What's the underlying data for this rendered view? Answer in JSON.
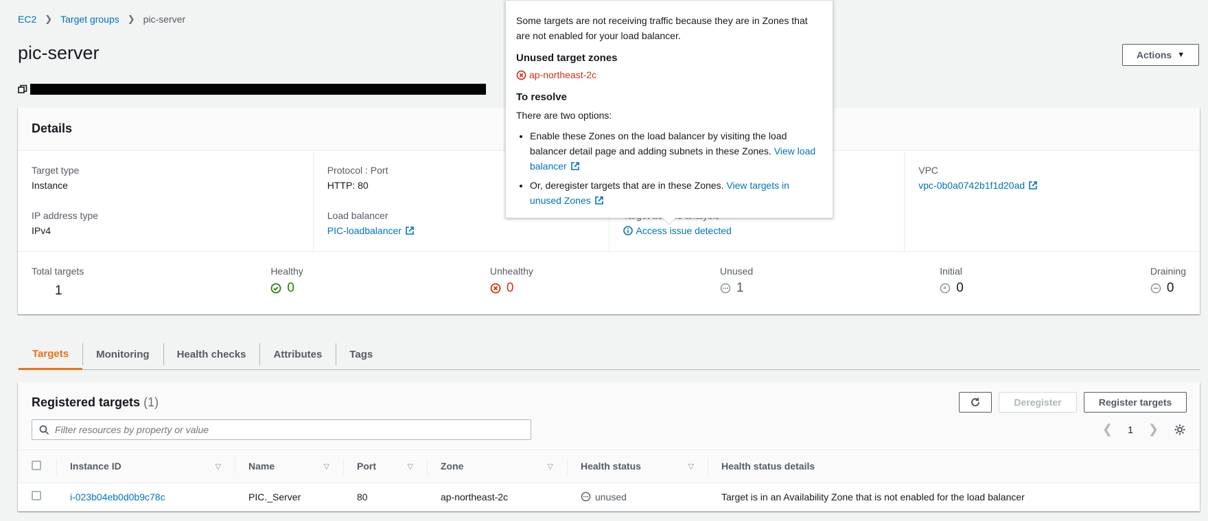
{
  "breadcrumb": {
    "items": [
      "EC2",
      "Target groups"
    ],
    "current": "pic-server"
  },
  "page_title": "pic-server",
  "actions_label": "Actions",
  "details": {
    "title": "Details",
    "target_type_label": "Target type",
    "target_type_value": "Instance",
    "ip_type_label": "IP address type",
    "ip_type_value": "IPv4",
    "protocol_label": "Protocol : Port",
    "protocol_value": "HTTP: 80",
    "lb_label": "Load balancer",
    "lb_value": "PIC-loadbalancer",
    "access_label": "Target access analysis",
    "access_value": "Access issue detected",
    "vpc_label": "VPC",
    "vpc_value": "vpc-0b0a0742b1f1d20ad"
  },
  "counts": {
    "total_label": "Total targets",
    "total_value": "1",
    "healthy_label": "Healthy",
    "healthy_value": "0",
    "unhealthy_label": "Unhealthy",
    "unhealthy_value": "0",
    "unused_label": "Unused",
    "unused_value": "1",
    "initial_label": "Initial",
    "initial_value": "0",
    "draining_label": "Draining",
    "draining_value": "0"
  },
  "tabs": [
    "Targets",
    "Monitoring",
    "Health checks",
    "Attributes",
    "Tags"
  ],
  "registered": {
    "title": "Registered targets",
    "count": "(1)",
    "deregister_label": "Deregister",
    "register_label": "Register targets",
    "search_placeholder": "Filter resources by property or value",
    "page": "1",
    "columns": [
      "Instance ID",
      "Name",
      "Port",
      "Zone",
      "Health status",
      "Health status details"
    ],
    "rows": [
      {
        "instance_id": "i-023b04eb0d0b9c78c",
        "name": "PIC._Server",
        "port": "80",
        "zone": "ap-northeast-2c",
        "health": "unused",
        "details": "Target is in an Availability Zone that is not enabled for the load balancer"
      }
    ]
  },
  "popover": {
    "intro": "Some targets are not receiving traffic because they are in Zones that are not enabled for your load balancer.",
    "unused_heading": "Unused target zones",
    "zone": "ap-northeast-2c",
    "resolve_heading": "To resolve",
    "options_intro": "There are two options:",
    "option1_text": "Enable these Zones on the load balancer by visiting the load balancer detail page and adding subnets in these Zones.",
    "option1_link": "View load balancer",
    "option2_text": "Or, deregister targets that are in these Zones.",
    "option2_link": "View targets in unused Zones"
  },
  "colors": {
    "link": "#0073bb",
    "active_tab": "#ec7211",
    "healthy": "#1d8102",
    "error": "#d13212"
  }
}
